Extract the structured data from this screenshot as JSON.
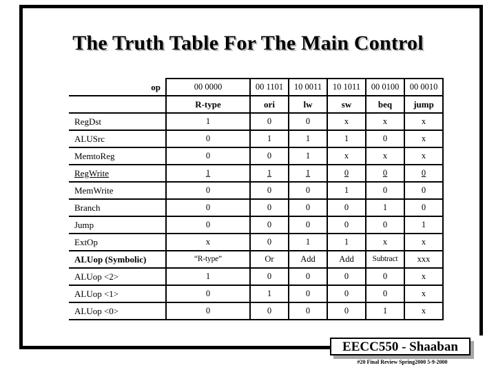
{
  "slide": {
    "title": "The Truth Table For The Main Control",
    "frame_color": "#000000",
    "title_shadow_color": "#bdbdbd"
  },
  "table": {
    "op_label": "op",
    "opcodes": [
      "00 0000",
      "00 1101",
      "10 0011",
      "10 1011",
      "00 0100",
      "00 0010"
    ],
    "instructions": [
      "R-type",
      "ori",
      "lw",
      "sw",
      "beq",
      "jump"
    ],
    "rows": [
      {
        "name": "RegDst",
        "underline": false,
        "bold": false,
        "values": [
          "1",
          "0",
          "0",
          "x",
          "x",
          "x"
        ]
      },
      {
        "name": "ALUSrc",
        "underline": false,
        "bold": false,
        "values": [
          "0",
          "1",
          "1",
          "1",
          "0",
          "x"
        ]
      },
      {
        "name": "MemtoReg",
        "underline": false,
        "bold": false,
        "values": [
          "0",
          "0",
          "1",
          "x",
          "x",
          "x"
        ]
      },
      {
        "name": "RegWrite",
        "underline": true,
        "bold": false,
        "values": [
          "1",
          "1",
          "1",
          "0",
          "0",
          "0"
        ]
      },
      {
        "name": "MemWrite",
        "underline": false,
        "bold": false,
        "values": [
          "0",
          "0",
          "0",
          "1",
          "0",
          "0"
        ]
      },
      {
        "name": "Branch",
        "underline": false,
        "bold": false,
        "values": [
          "0",
          "0",
          "0",
          "0",
          "1",
          "0"
        ]
      },
      {
        "name": "Jump",
        "underline": false,
        "bold": false,
        "values": [
          "0",
          "0",
          "0",
          "0",
          "0",
          "1"
        ]
      },
      {
        "name": "ExtOp",
        "underline": false,
        "bold": false,
        "values": [
          "x",
          "0",
          "1",
          "1",
          "x",
          "x"
        ]
      },
      {
        "name": "ALUop (Symbolic)",
        "underline": false,
        "bold": true,
        "values": [
          "“R-type”",
          "Or",
          "Add",
          "Add",
          "Subtract",
          "xxx"
        ]
      },
      {
        "name": "ALUop <2>",
        "underline": false,
        "bold": false,
        "values": [
          "1",
          "0",
          "0",
          "0",
          "0",
          "x"
        ]
      },
      {
        "name": "ALUop <1>",
        "underline": false,
        "bold": false,
        "values": [
          "0",
          "1",
          "0",
          "0",
          "0",
          "x"
        ]
      },
      {
        "name": "ALUop <0>",
        "underline": false,
        "bold": false,
        "values": [
          "0",
          "0",
          "0",
          "0",
          "1",
          "x"
        ]
      }
    ]
  },
  "footer": {
    "badge": "EECC550 - Shaaban",
    "subtext": "#20  Final Review   Spring2000   5-9-2000"
  }
}
